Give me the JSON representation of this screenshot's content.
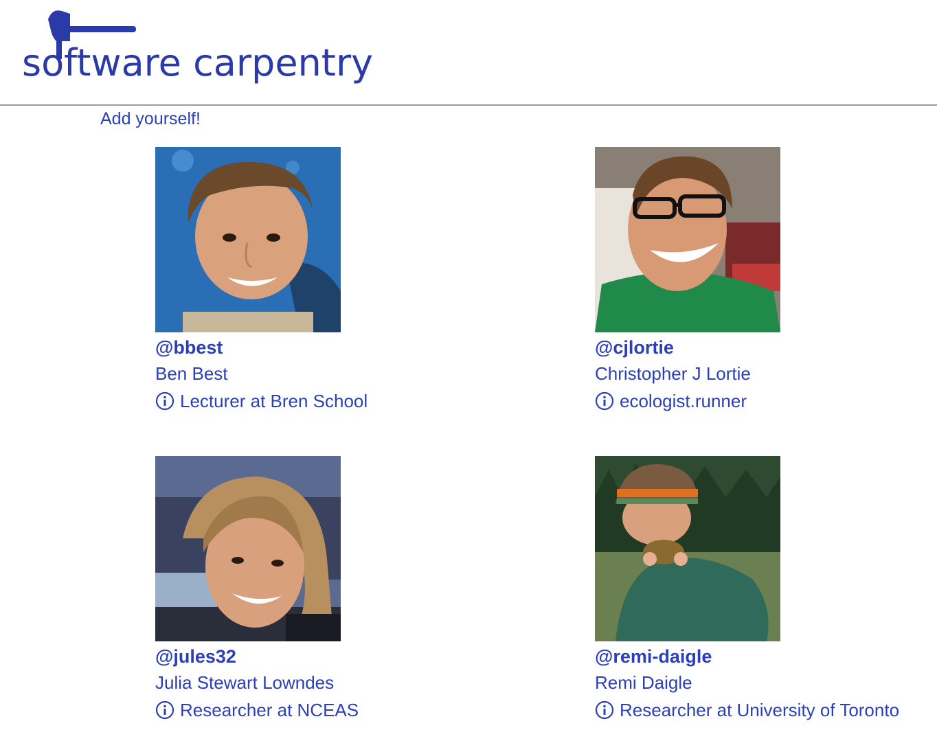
{
  "header": {
    "logo_text": "software carpentry",
    "brand_color": "#2a3aa6"
  },
  "add_link": "Add yourself!",
  "people": [
    {
      "handle": "@bbest",
      "name": "Ben Best",
      "bio": "Lecturer at Bren School",
      "photo": "portrait-blue-background"
    },
    {
      "handle": "@cjlortie",
      "name": "Christopher J Lortie",
      "bio": "ecologist.runner",
      "photo": "portrait-glasses-green-shirt"
    },
    {
      "handle": "@jules32",
      "name": "Julia Stewart Lowndes",
      "bio": "Researcher at NCEAS",
      "photo": "portrait-dusk-outdoor"
    },
    {
      "handle": "@remi-daigle",
      "name": "Remi Daigle",
      "bio": "Researcher at University of Toronto",
      "photo": "portrait-forest-crab"
    }
  ],
  "icons": {
    "bio_icon": "info-circle-icon",
    "logo_icon": "hammer-icon"
  }
}
